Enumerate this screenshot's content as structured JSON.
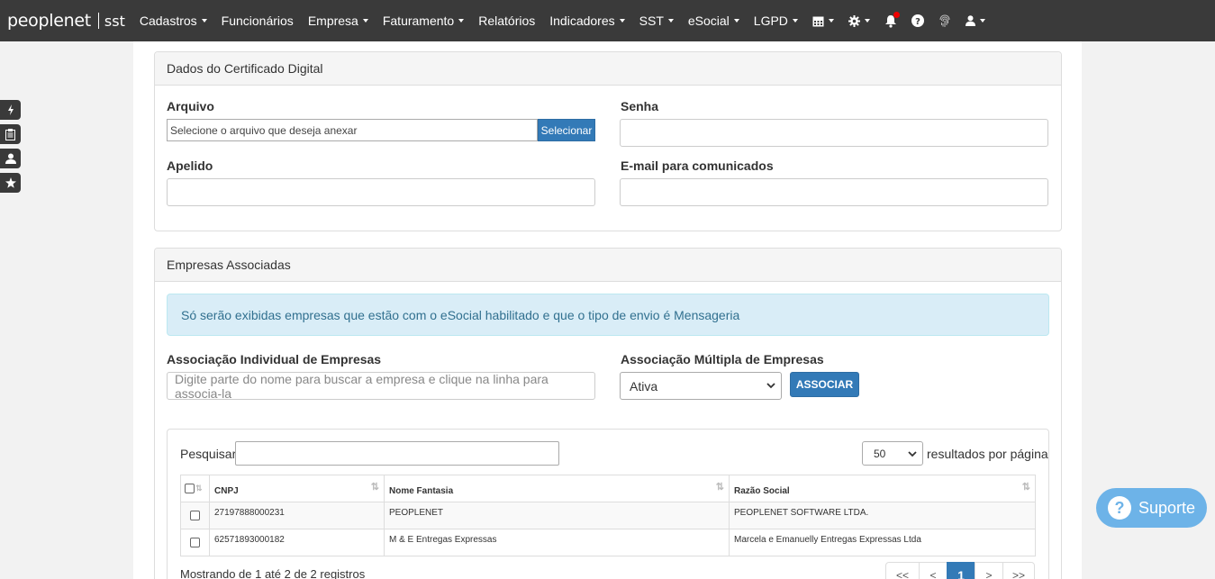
{
  "brand": {
    "main": "peoplenet",
    "sub": "sst"
  },
  "nav": [
    {
      "label": "Cadastros",
      "dropdown": true
    },
    {
      "label": "Funcionários",
      "dropdown": false
    },
    {
      "label": "Empresa",
      "dropdown": true
    },
    {
      "label": "Faturamento",
      "dropdown": true
    },
    {
      "label": "Relatórios",
      "dropdown": false
    },
    {
      "label": "Indicadores",
      "dropdown": true
    },
    {
      "label": "SST",
      "dropdown": true
    },
    {
      "label": "eSocial",
      "dropdown": true
    },
    {
      "label": "LGPD",
      "dropdown": true
    }
  ],
  "nav_icons": [
    "calendar-icon",
    "gear-icon",
    "bell-icon",
    "help-icon",
    "fingerprint-icon",
    "user-icon"
  ],
  "side_buttons": [
    "bolt-icon",
    "clipboard-icon",
    "person-icon",
    "star-icon"
  ],
  "certificado": {
    "heading": "Dados do Certificado Digital",
    "arquivo_label": "Arquivo",
    "arquivo_placeholder": "Selecione o arquivo que deseja anexar",
    "selecionar_label": "Selecionar",
    "senha_label": "Senha",
    "apelido_label": "Apelido",
    "email_label": "E-mail para comunicados"
  },
  "empresas": {
    "heading": "Empresas Associadas",
    "alert": "Só serão exibidas empresas que estão com o eSocial habilitado e que o tipo de envio é Mensageria",
    "individual_label": "Associação Individual de Empresas",
    "individual_placeholder": "Digite parte do nome para buscar a empresa e clique na linha para associa-la",
    "multipla_label": "Associação Múltipla de Empresas",
    "multipla_value": "Ativa",
    "associar_label": "ASSOCIAR"
  },
  "table": {
    "search_label": "Pesquisar",
    "page_length": "50",
    "page_length_label": "resultados por página",
    "columns": [
      "CNPJ",
      "Nome Fantasia",
      "Razão Social"
    ],
    "rows": [
      {
        "cnpj": "27197888000231",
        "fantasia": "PEOPLENET",
        "razao": "PEOPLENET SOFTWARE LTDA."
      },
      {
        "cnpj": "62571893000182",
        "fantasia": "M & E Entregas Expressas",
        "razao": "Marcela e Emanuelly Entregas Expressas Ltda"
      }
    ],
    "info": "Mostrando de 1 até 2 de 2 registros",
    "pager": [
      "<<",
      "<",
      "1",
      ">",
      ">>"
    ]
  },
  "support_label": "Suporte"
}
